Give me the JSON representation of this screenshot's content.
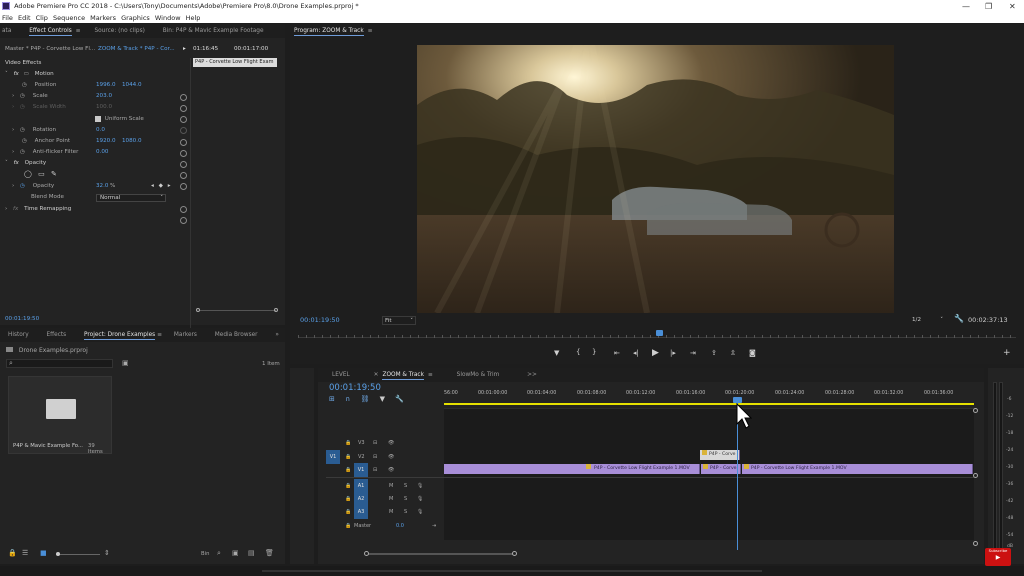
{
  "app": {
    "title": "Adobe Premiere Pro CC 2018 - C:\\Users\\Tony\\Documents\\Adobe\\Premiere Pro\\8.0\\Drone Examples.prproj *",
    "menu": [
      "File",
      "Edit",
      "Clip",
      "Sequence",
      "Markers",
      "Graphics",
      "Window",
      "Help"
    ],
    "window_controls": {
      "minimize": "—",
      "maximize": "❐",
      "close": "✕"
    }
  },
  "top_left_panel": {
    "tabs": [
      "ata",
      "Effect Controls",
      "Source: (no clips)",
      "Bin: P4P & Mavic Example Footage"
    ],
    "active_tab": "Effect Controls",
    "menu_icon": "≡",
    "master_label": "Master * P4P - Corvette Low Fl...",
    "sequence_label": "ZOOM & Track * P4P - Cor...",
    "times": [
      "01:16:45",
      "00:01:17:00"
    ],
    "clip_label": "P4P - Corvette Low Flight Exam",
    "section_video_effects": "Video Effects",
    "motion": "Motion",
    "position_label": "Position",
    "position_x": "1996.0",
    "position_y": "1044.0",
    "scale_label": "Scale",
    "scale_value": "203.0",
    "scale_width_label": "Scale Width",
    "scale_width_value": "100.0",
    "uniform_scale": "Uniform Scale",
    "rotation_label": "Rotation",
    "rotation_value": "0.0",
    "anchor_label": "Anchor Point",
    "anchor_x": "1920.0",
    "anchor_y": "1080.0",
    "antiflicker_label": "Anti-flicker Filter",
    "antiflicker_value": "0.00",
    "opacity_section": "Opacity",
    "opacity_label": "Opacity",
    "opacity_value": "32.0",
    "opacity_unit": "%",
    "blend_label": "Blend Mode",
    "blend_value": "Normal",
    "time_remap": "Time Remapping",
    "timecode": "00:01:19:50"
  },
  "program_monitor": {
    "tab": "Program: ZOOM & Track",
    "menu_icon": "≡",
    "timecode": "00:01:19:50",
    "fit": "Fit",
    "resolution": "1/2",
    "duration": "00:02:37:13"
  },
  "project_panel": {
    "tabs": [
      "History",
      "Effects",
      "Project: Drone Examples",
      "Markers",
      "Media Browser"
    ],
    "active_tab": "Project: Drone Examples",
    "menu_icon": "≡",
    "more": "»",
    "project_file": "Drone Examples.prproj",
    "item_count": "1 Item",
    "bin_name": "P4P & Mavic Example Fo...",
    "bin_items": "39 Items",
    "bin_label": "Bin"
  },
  "timeline": {
    "tabs": [
      "LEVEL",
      "ZOOM & Track",
      "SlowMo & Trim"
    ],
    "active_tab": "ZOOM & Track",
    "menu_icon": "≡",
    "more": ">>",
    "timecode": "00:01:19:50",
    "ruler": [
      "56:00",
      "00:01:00:00",
      "00:01:04:00",
      "00:01:08:00",
      "00:01:12:00",
      "00:01:16:00",
      "00:01:20:00",
      "00:01:24:00",
      "00:01:28:00",
      "00:01:32:00",
      "00:01:36:00"
    ],
    "video_tracks": [
      "V3",
      "V2",
      "V1"
    ],
    "audio_tracks": [
      "A1",
      "A2",
      "A3"
    ],
    "source_v": "V1",
    "master_label": "Master",
    "master_value": "0.0",
    "clip_v2": "P4P - Corve",
    "clip_v1_a": "P4P - Corvette Low Flight Example 1.MOV",
    "clip_v1_b": "P4P - Corve",
    "clip_v1_c": "P4P - Corvette Low Flight Example 1.MOV"
  },
  "audio_meter": {
    "labels": [
      "-6",
      "-12",
      "-18",
      "-24",
      "-30",
      "-36",
      "-42",
      "-48",
      "-54"
    ],
    "bottom": "dB"
  },
  "subscribe": {
    "label": "Subscribe"
  },
  "colors": {
    "accent": "#5aa0e8",
    "clip": "#a88ed8",
    "playhead": "#4a8fd8",
    "work_area": "#e5e000"
  }
}
